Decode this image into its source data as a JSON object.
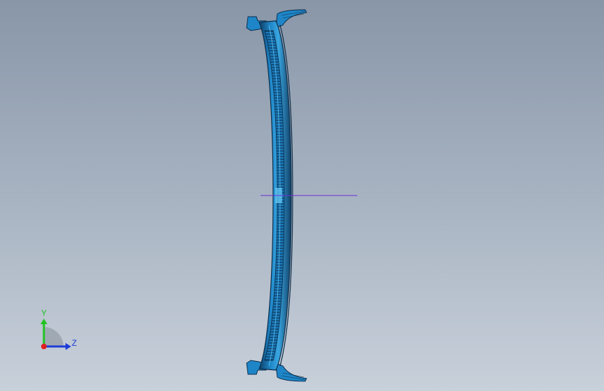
{
  "viewport": {
    "background_top": "#8896a8",
    "background_bottom": "#c8d0da"
  },
  "model": {
    "part_color": "#1e86c8",
    "part_dark": "#0f3f66",
    "part_highlight": "#5fc2ef",
    "section_line_color": "#6a2fd0"
  },
  "triad": {
    "y_label": "Y",
    "z_label": "Z",
    "y_color": "#22c222",
    "z_color": "#1d3cd8",
    "x_color": "#e02020"
  }
}
